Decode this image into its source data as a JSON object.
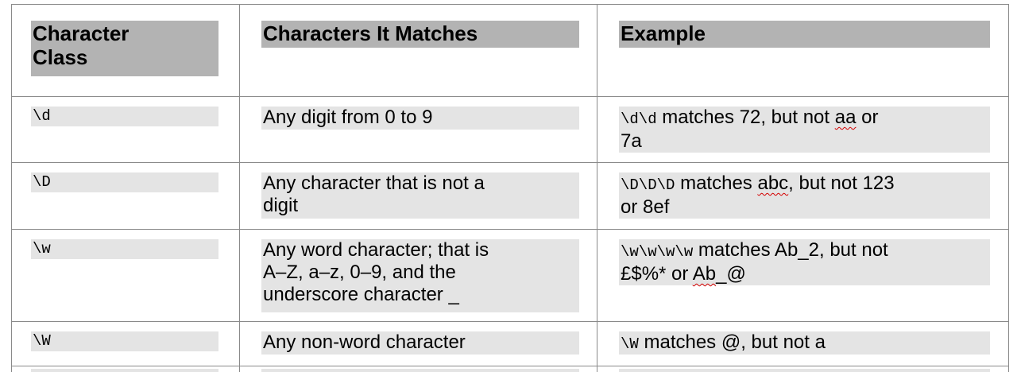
{
  "table": {
    "headers": [
      "Character Class",
      "Characters It Matches",
      "Example"
    ],
    "header_col1_line1": "Character",
    "header_col1_line2": "Class",
    "rows": [
      {
        "class": "\\d",
        "matches": "Any digit from 0 to 9",
        "example": {
          "code": "\\d\\d",
          "line1_text": " matches 72, but not ",
          "squiggle": "aa",
          "line1_end": " or",
          "line2": "7a"
        }
      },
      {
        "class": "\\D",
        "matches_line1": "Any character that is not a",
        "matches_line2": "digit",
        "example": {
          "code": "\\D\\D\\D",
          "line1_text": " matches ",
          "squiggle": "abc",
          "line1_end": ", but not 123",
          "line2": "or 8ef"
        }
      },
      {
        "class": "\\w",
        "matches_line1": "Any word character; that is",
        "matches_line2": "A–Z, a–z, 0–9, and the",
        "matches_line3": "underscore character _",
        "example": {
          "code": "\\w\\w\\w\\w",
          "line1_text": " matches Ab_2, but not",
          "line2_start": "£$%* or ",
          "squiggle": "Ab",
          "line2_end": "_@"
        }
      },
      {
        "class": "\\W",
        "matches": "Any non-word character",
        "example": {
          "code": "\\W",
          "line1_text": " matches @, but not a"
        }
      }
    ]
  },
  "colors": {
    "header_fill": "#b3b3b3",
    "cell_fill": "#e4e4e4",
    "grid_line": "#8a8a8a",
    "spellcheck": "#d40000"
  }
}
